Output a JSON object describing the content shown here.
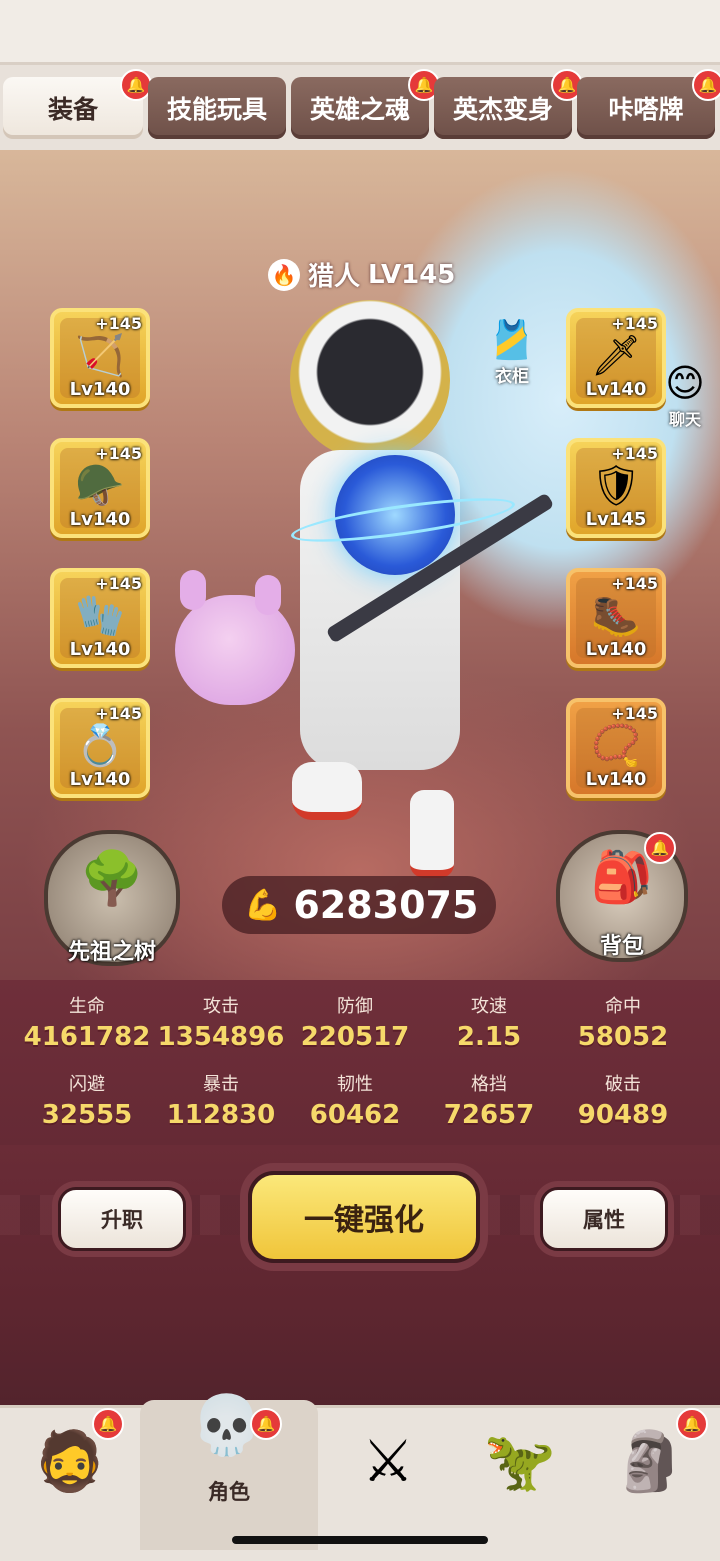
{
  "tabs": [
    "装备",
    "技能玩具",
    "英雄之魂",
    "英杰变身",
    "咔嗒牌"
  ],
  "active_tab": "装备",
  "character": {
    "class_name": "猎人",
    "level": "LV145"
  },
  "left_slots": [
    {
      "plus": "+145",
      "level": "Lv140",
      "icon": "bow-icon"
    },
    {
      "plus": "+145",
      "level": "Lv140",
      "icon": "helmet-icon"
    },
    {
      "plus": "+145",
      "level": "Lv140",
      "icon": "gauntlet-icon"
    },
    {
      "plus": "+145",
      "level": "Lv140",
      "icon": "ring-icon"
    }
  ],
  "right_slots": [
    {
      "plus": "+145",
      "level": "Lv140",
      "icon": "weapon-icon"
    },
    {
      "plus": "+145",
      "level": "Lv145",
      "icon": "armor-icon"
    },
    {
      "plus": "+145",
      "level": "Lv140",
      "icon": "boots-icon"
    },
    {
      "plus": "+145",
      "level": "Lv140",
      "icon": "necklace-icon"
    }
  ],
  "wardrobe_label": "衣柜",
  "chat_label": "聊天",
  "ancestor_tree_label": "先祖之树",
  "backpack_label": "背包",
  "power": "6283075",
  "stats": [
    {
      "label": "生命",
      "value": "4161782"
    },
    {
      "label": "攻击",
      "value": "1354896"
    },
    {
      "label": "防御",
      "value": "220517"
    },
    {
      "label": "攻速",
      "value": "2.15"
    },
    {
      "label": "命中",
      "value": "58052"
    },
    {
      "label": "闪避",
      "value": "32555"
    },
    {
      "label": "暴击",
      "value": "112830"
    },
    {
      "label": "韧性",
      "value": "60462"
    },
    {
      "label": "格挡",
      "value": "72657"
    },
    {
      "label": "破击",
      "value": "90489"
    }
  ],
  "buttons": {
    "promote": "升职",
    "one_key_enhance": "一键强化",
    "attributes": "属性"
  },
  "bottom_nav": [
    {
      "icon": "caveman-icon",
      "label": ""
    },
    {
      "icon": "character-icon",
      "label": "角色"
    },
    {
      "icon": "sword-icon",
      "label": ""
    },
    {
      "icon": "dino-icon",
      "label": ""
    },
    {
      "icon": "totem-icon",
      "label": ""
    }
  ],
  "colors": {
    "gold_slot": "#f6d35a",
    "orange_slot": "#f0a146",
    "stat_value": "#f6d96a",
    "panel": "#6f2f3a",
    "badge": "#e53a3a"
  }
}
